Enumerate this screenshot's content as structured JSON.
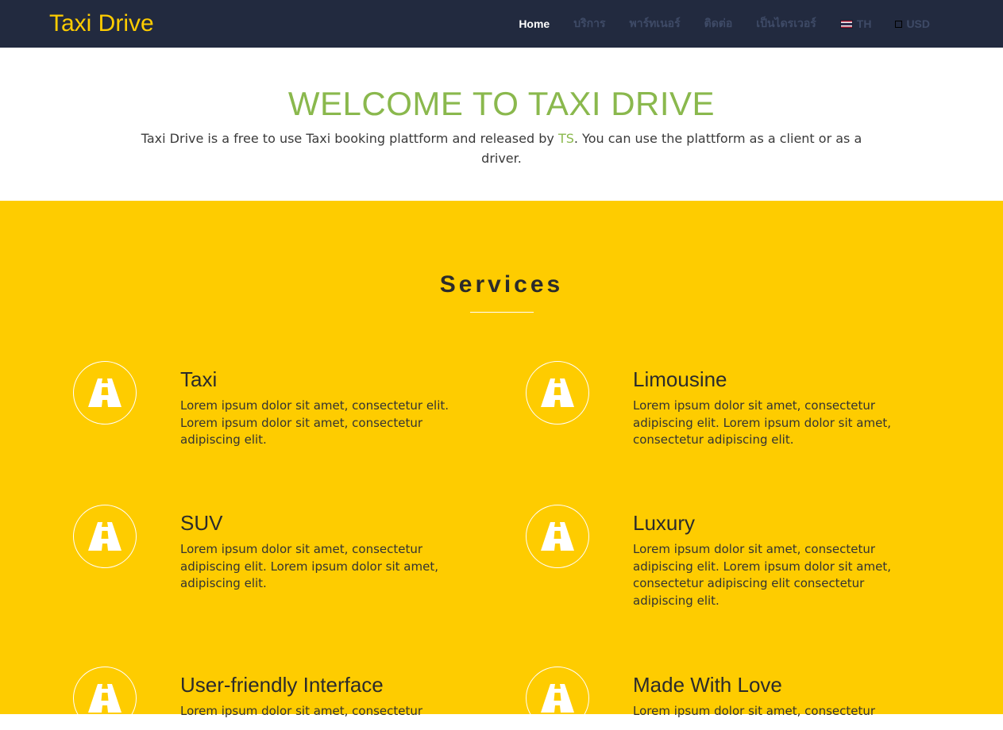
{
  "navbar": {
    "brand": "Taxi Drive",
    "items": [
      {
        "label": "Home",
        "active": true
      },
      {
        "label": "บริการ"
      },
      {
        "label": "พาร์ทเนอร์"
      },
      {
        "label": "ติดต่อ"
      },
      {
        "label": "เป็นไดรเวอร์"
      }
    ],
    "language": {
      "label": "TH",
      "icon": "thai-flag-icon"
    },
    "currency": {
      "label": "USD",
      "icon": "currency-icon"
    }
  },
  "welcome": {
    "title": "WELCOME TO TAXI DRIVE",
    "text_before": "Taxi Drive is a free to use Taxi booking plattform and released by ",
    "link": "TS",
    "text_after": ". You can use the plattform as a client or as a driver."
  },
  "services": {
    "title": "Services",
    "items": [
      {
        "title": "Taxi",
        "text": "Lorem ipsum dolor sit amet, consectetur elit. Lorem ipsum dolor sit amet, consectetur adipiscing elit.",
        "icon": "road-icon"
      },
      {
        "title": "Limousine",
        "text": "Lorem ipsum dolor sit amet, consectetur adipiscing elit. Lorem ipsum dolor sit amet, consectetur adipiscing elit.",
        "icon": "road-icon"
      },
      {
        "title": "SUV",
        "text": "Lorem ipsum dolor sit amet, consectetur adipiscing elit. Lorem ipsum dolor sit amet, adipiscing elit.",
        "icon": "road-icon"
      },
      {
        "title": "Luxury",
        "text": "Lorem ipsum dolor sit amet, consectetur adipiscing elit. Lorem ipsum dolor sit amet, consectetur adipiscing elit consectetur adipiscing elit.",
        "icon": "road-icon"
      },
      {
        "title": "User-friendly Interface",
        "text": "Lorem ipsum dolor sit amet, consectetur",
        "icon": "road-icon"
      },
      {
        "title": "Made With Love",
        "text": "Lorem ipsum dolor sit amet, consectetur",
        "icon": "road-icon"
      }
    ]
  },
  "colors": {
    "navbar_bg": "#222a3f",
    "brand": "#fecc00",
    "accent_green": "#8ab84d",
    "services_bg": "#fecc00"
  }
}
